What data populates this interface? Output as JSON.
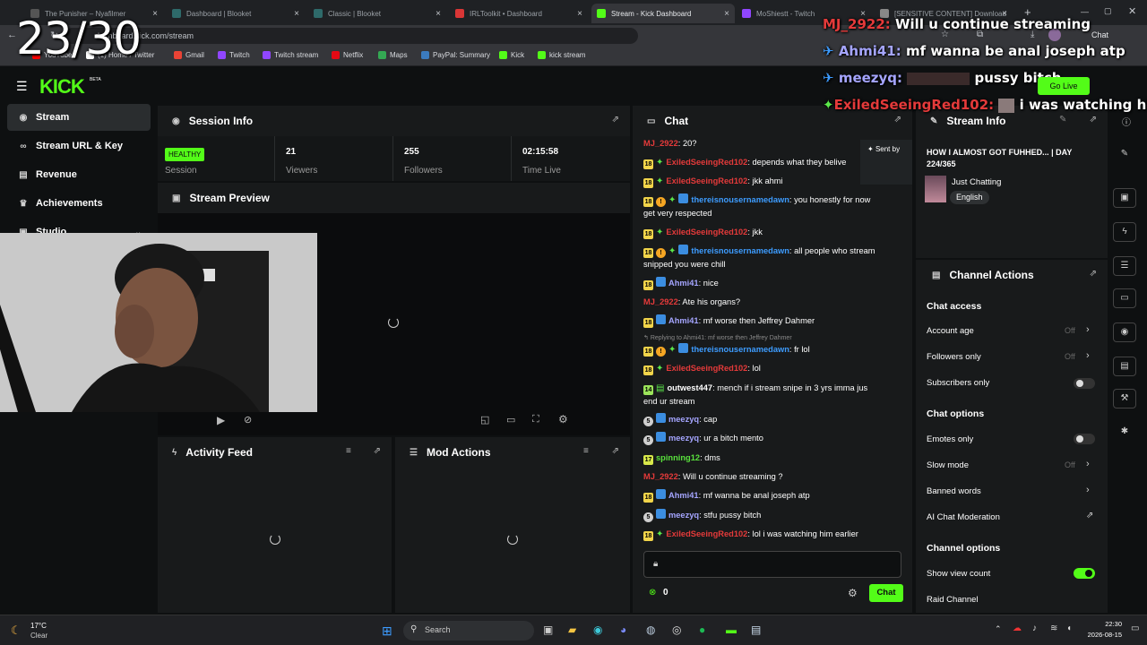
{
  "browser": {
    "tabs": [
      {
        "label": "The Punisher – Nyafilmer",
        "color": "#555"
      },
      {
        "label": "Dashboard | Blooket",
        "color": "#2e6a6a"
      },
      {
        "label": "Classic | Blooket",
        "color": "#2e6a6a"
      },
      {
        "label": "IRLToolkit • Dashboard",
        "color": "#d93636"
      },
      {
        "label": "Stream - Kick Dashboard",
        "color": "#53fc18"
      },
      {
        "label": "MoShiestt - Twitch",
        "color": "#9146ff"
      },
      {
        "label": "[SENSITIVE CONTENT] Download",
        "color": "#888"
      }
    ],
    "url": "dashboard.kick.com/stream",
    "chat_button": "Chat",
    "bookmarks": [
      {
        "label": "YouTube",
        "color": "#ff0000"
      },
      {
        "label": "(1) Home / Twitter",
        "color": "#ffffff"
      },
      {
        "label": "Gmail",
        "color": "#ea4335"
      },
      {
        "label": "Twitch",
        "color": "#9146ff"
      },
      {
        "label": "Twitch stream",
        "color": "#9146ff"
      },
      {
        "label": "Netflix",
        "color": "#e50914"
      },
      {
        "label": "Maps",
        "color": "#34a853"
      },
      {
        "label": "PayPal: Summary",
        "color": "#3b7bbf"
      },
      {
        "label": "Kick",
        "color": "#53fc18"
      },
      {
        "label": "kick stream",
        "color": "#53fc18"
      }
    ]
  },
  "kick": {
    "logo": "KICK",
    "logo_sup": "BETA",
    "nav": [
      {
        "label": "Stream",
        "icon": "broadcast-icon"
      },
      {
        "label": "Stream URL & Key",
        "icon": "link-icon"
      },
      {
        "label": "Revenue",
        "icon": "chart-icon"
      },
      {
        "label": "Achievements",
        "icon": "trophy-icon"
      },
      {
        "label": "Studio",
        "icon": "studio-icon"
      }
    ]
  },
  "session": {
    "title": "Session Info",
    "status": "HEALTHY",
    "status_label": "Session",
    "viewers": "21",
    "viewers_label": "Viewers",
    "followers": "255",
    "followers_label": "Followers",
    "time_live": "02:15:58",
    "time_live_label": "Time Live"
  },
  "preview": {
    "title": "Stream Preview"
  },
  "activity": {
    "title": "Activity Feed"
  },
  "mod": {
    "title": "Mod Actions"
  },
  "chat": {
    "title": "Chat",
    "sent_by": "Sent by",
    "reply_context": "Replying to Ahmi41: mf worse then Jeffrey Dahmer",
    "messages": [
      {
        "user": "MJ_2922",
        "text": ": 20?"
      },
      {
        "badge": "18",
        "user": "ExiledSeeingRed102",
        "text": ": depends what they belive"
      },
      {
        "badge": "18",
        "user": "ExiledSeeingRed102",
        "text": ": jkk ahmi"
      },
      {
        "badge": "18",
        "user": "thereisnousernamedawn",
        "text": ": you honestly for now",
        "text2": "get very respected"
      },
      {
        "badge": "18",
        "user": "ExiledSeeingRed102",
        "text": ": jkk"
      },
      {
        "badge": "18",
        "user": "thereisnousernamedawn",
        "text": ": all people who stream",
        "text2": "snipped you were chill"
      },
      {
        "badge": "18",
        "user": "Ahmi41",
        "text": ": nice"
      },
      {
        "user": "MJ_2922",
        "text": ": Ate his organs?"
      },
      {
        "badge": "18",
        "user": "Ahmi41",
        "text": ": mf worse then Jeffrey Dahmer"
      },
      {
        "badge": "18",
        "user": "thereisnousernamedawn",
        "text": ": fr lol"
      },
      {
        "badge": "18",
        "user": "ExiledSeeingRed102",
        "text": ": lol"
      },
      {
        "badge": "14",
        "user": "outwest447",
        "text": ": mench if i stream snipe in 3 yrs imma jus",
        "text2": "end ur stream"
      },
      {
        "badge": "5",
        "user": "meezyq",
        "text": ": cap"
      },
      {
        "badge": "5",
        "user": "meezyq",
        "text": ": ur a bitch mento"
      },
      {
        "badge": "17",
        "user": "spinning12",
        "text": ": dms"
      },
      {
        "user": "MJ_2922",
        "text": ": Will u continue streaming ?"
      },
      {
        "badge": "18",
        "user": "Ahmi41",
        "text": ": mf wanna be anal joseph atp"
      },
      {
        "badge": "5",
        "user": "meezyq",
        "text": ": stfu pussy bitch"
      },
      {
        "badge": "18",
        "user": "ExiledSeeingRed102",
        "text": ": lol i was watching him earlier"
      }
    ],
    "viewer_count": "0",
    "send_label": "Chat"
  },
  "stream_info": {
    "title": "Stream Info",
    "stream_title": "HOW I ALMOST GOT FUHHED... | DAY",
    "stream_title_2": "224/365",
    "category": "Just Chatting",
    "language": "English"
  },
  "channel_actions": {
    "title": "Channel Actions",
    "chat_access": "Chat access",
    "account_age": "Account age",
    "account_age_value": "Off",
    "followers_only": "Followers only",
    "followers_only_value": "Off",
    "subscribers_only": "Subscribers only",
    "chat_options": "Chat options",
    "emotes_only": "Emotes only",
    "slow_mode": "Slow mode",
    "slow_mode_value": "Off",
    "banned_words": "Banned words",
    "ai_moderation": "AI Chat Moderation",
    "channel_options": "Channel options",
    "show_view_count": "Show view count",
    "raid_channel": "Raid Channel"
  },
  "overlay": {
    "counter": "23/30",
    "lines": [
      {
        "user": "MJ_2922:",
        "text": "Will u continue streaming",
        "color": "#e43a3a"
      },
      {
        "user": "Ahmi41:",
        "text": "mf wanna be anal joseph atp",
        "color": "#a5a5ff"
      },
      {
        "user": "meezyq:",
        "text": "pussy bitch",
        "color": "#a5a5ff"
      },
      {
        "user": "ExiledSeeingRed102:",
        "text": "i was watching him e",
        "color": "#e43a3a"
      }
    ],
    "go_live": "Go Live"
  },
  "taskbar": {
    "weather_temp": "17°C",
    "weather_desc": "Clear",
    "search": "Search",
    "time": "22:30",
    "date": "2026-08-15"
  }
}
